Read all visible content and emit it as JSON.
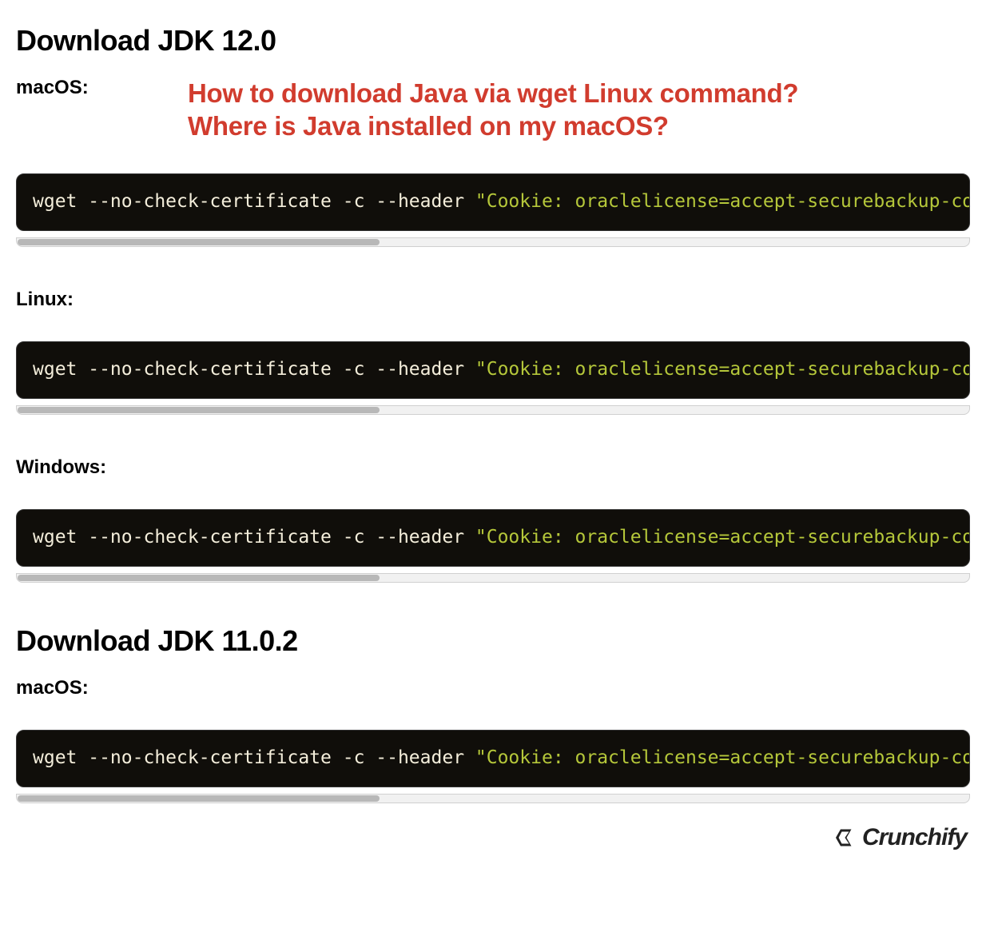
{
  "sections": [
    {
      "heading": "Download JDK 12.0",
      "items": [
        {
          "os": "macOS:",
          "highlight": "How to download Java via wget Linux command?\nWhere is Java installed on my macOS?",
          "cmd_prefix": "wget --no-check-certificate -c --header ",
          "cmd_string": "\"Cookie: oraclelicense=accept-securebackup-co"
        },
        {
          "os": "Linux:",
          "cmd_prefix": "wget --no-check-certificate -c --header ",
          "cmd_string": "\"Cookie: oraclelicense=accept-securebackup-co"
        },
        {
          "os": "Windows:",
          "cmd_prefix": "wget --no-check-certificate -c --header ",
          "cmd_string": "\"Cookie: oraclelicense=accept-securebackup-co"
        }
      ]
    },
    {
      "heading": "Download JDK 11.0.2",
      "items": [
        {
          "os": "macOS:",
          "cmd_prefix": "wget --no-check-certificate -c --header ",
          "cmd_string": "\"Cookie: oraclelicense=accept-securebackup-co"
        }
      ]
    }
  ],
  "brand": "Crunchify"
}
